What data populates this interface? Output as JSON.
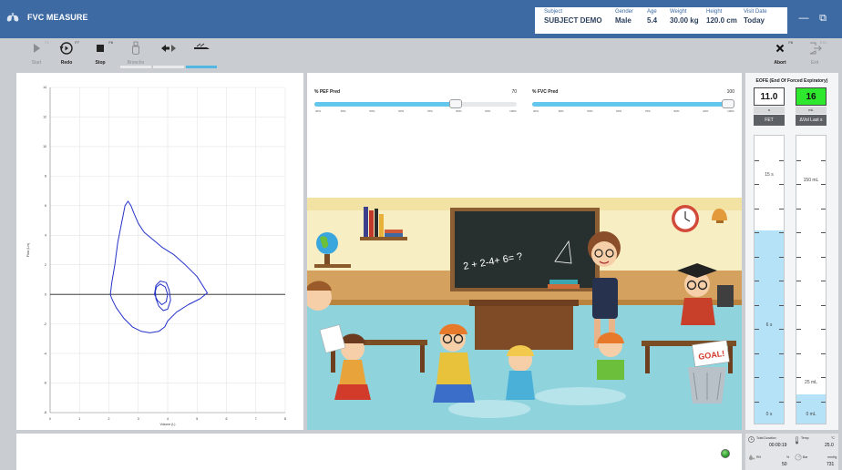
{
  "app": {
    "title": "FVC MEASURE",
    "accent": "#3d6aa3"
  },
  "subject": {
    "subject_label": "Subject",
    "subject_value": "SUBJECT DEMO",
    "gender_label": "Gender",
    "gender_value": "Male",
    "age_label": "Age",
    "age_value": "5.4",
    "weight_label": "Weight",
    "weight_value": "30.00 kg",
    "height_label": "Height",
    "height_value": "120.0 cm",
    "visit_label": "Visit Date",
    "visit_value": "Today"
  },
  "window": {
    "minimize": "—",
    "restore": "⧉"
  },
  "toolbar": {
    "start": {
      "label": "Start",
      "key": "F1",
      "icon": "play-icon"
    },
    "redo": {
      "label": "Redo",
      "key": "F7",
      "icon": "redo-icon"
    },
    "stop": {
      "label": "Stop",
      "key": "F6",
      "icon": "stop-icon"
    },
    "bronchodilator": {
      "label": "Broncho",
      "key": "",
      "icon": "bronchodilator-icon"
    },
    "direction": {
      "icon": "direction-arrows-icon"
    },
    "incentive": {
      "icon": "incentive-icon"
    },
    "abort": {
      "label": "Abort",
      "key": "F8",
      "icon": "close-icon"
    },
    "exit": {
      "label": "Exit",
      "key": "ESC",
      "icon": "exit-icon"
    }
  },
  "chart_data": {
    "type": "line",
    "title": "",
    "xlabel": "Volume (L)",
    "ylabel": "Flow (L/s)",
    "xlim": [
      0,
      8
    ],
    "ylim": [
      -8,
      14
    ],
    "xticks": [
      0,
      1,
      2,
      3,
      4,
      5,
      6,
      7,
      8
    ],
    "yticks": [
      -8,
      -6,
      -4,
      -2,
      0,
      2,
      4,
      6,
      8,
      10,
      12,
      14
    ],
    "grid": true,
    "series": [
      {
        "color": "#2432c8",
        "x": [
          2.05,
          2.1,
          2.2,
          2.3,
          2.45,
          2.55,
          2.65,
          2.75,
          2.85,
          3.0,
          3.2,
          3.5,
          3.8,
          4.2,
          4.6,
          5.0,
          5.35,
          5.1,
          4.7,
          4.3,
          4.0,
          3.9,
          3.7,
          3.4,
          3.1,
          2.8,
          2.5,
          2.25,
          2.15,
          2.08,
          2.05
        ],
        "y": [
          0.0,
          0.8,
          2.0,
          3.5,
          5.0,
          6.0,
          6.3,
          6.0,
          5.5,
          4.8,
          4.2,
          3.7,
          3.2,
          2.7,
          2.0,
          1.2,
          0.1,
          -0.3,
          -0.7,
          -1.2,
          -1.8,
          -2.2,
          -2.5,
          -2.6,
          -2.5,
          -2.2,
          -1.6,
          -0.9,
          -0.5,
          -0.2,
          0.0
        ]
      },
      {
        "color": "#2432c8",
        "x": [
          3.55,
          3.6,
          3.75,
          3.95,
          4.05,
          4.1,
          4.0,
          3.85,
          3.7,
          3.6,
          3.58,
          3.62,
          3.75,
          3.92,
          4.0,
          3.95,
          3.8,
          3.65,
          3.55
        ],
        "y": [
          0.0,
          0.6,
          0.9,
          0.8,
          0.3,
          -0.4,
          -1.0,
          -1.1,
          -0.8,
          -0.3,
          0.2,
          0.5,
          0.7,
          0.5,
          0.0,
          -0.5,
          -0.7,
          -0.4,
          0.0
        ]
      }
    ]
  },
  "sliders": {
    "pef": {
      "label": "% PEF Pred",
      "value": "70",
      "fraction": 0.7,
      "ticks": [
        "30%",
        "40%",
        "50%",
        "60%",
        "70%",
        "80%",
        "90%",
        "100%"
      ]
    },
    "fvc": {
      "label": "% FVC Pred",
      "value": "100",
      "fraction": 1.0,
      "ticks": [
        "30%",
        "40%",
        "50%",
        "60%",
        "70%",
        "80%",
        "90%",
        "100%"
      ]
    }
  },
  "scene": {
    "equation": "2 + 2-4+ 6= ?",
    "goal": "GOAL!"
  },
  "eofe": {
    "title": "EOFE (End Of Forced Expiratory)",
    "fet": {
      "value": "11.0",
      "unit": "s",
      "name": "FET",
      "value_bg": "#ffffff",
      "fill_fraction": 0.67,
      "top_label": "15 s",
      "mid_label": "6 s",
      "bottom_label": "0 s"
    },
    "vol": {
      "value": "16",
      "unit": "mL",
      "name": "ΔVol Last s",
      "value_bg": "#2ee82e",
      "fill_fraction": 0.1,
      "top_label": "150 mL",
      "mid_label": "25 mL",
      "bottom_label": "0 mL"
    }
  },
  "status": {
    "duration_label": "Total Duration",
    "duration_value": "00:00:19",
    "temp_label": "Temp",
    "temp_unit": "°C",
    "temp_value": "25.0",
    "rh_label": "RH",
    "rh_unit": "%",
    "rh_value": "50",
    "bar_label": "Bar",
    "bar_unit": "mmHg",
    "bar_value": "731"
  }
}
